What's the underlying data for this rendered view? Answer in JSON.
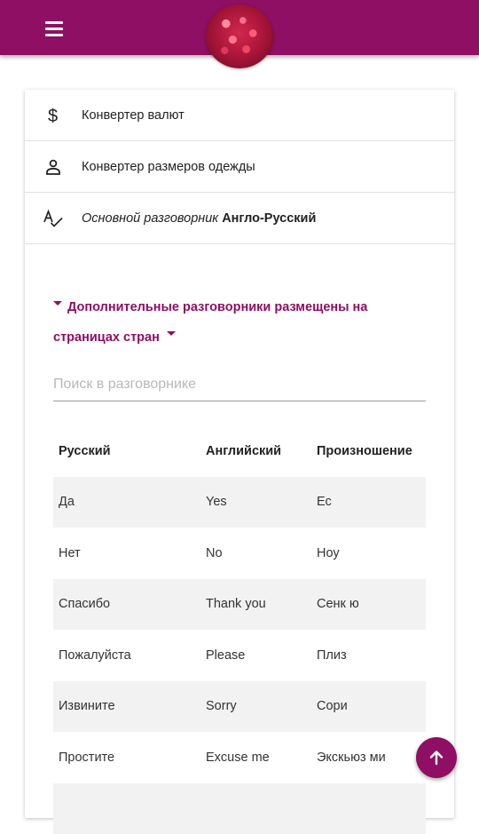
{
  "brand_color": "#8e0f63",
  "header": {
    "menu_icon": "hamburger-menu-icon",
    "avatar_icon": "raspberry-avatar"
  },
  "nav": [
    {
      "icon": "dollar-icon",
      "label": "Конвертер валют"
    },
    {
      "icon": "person-icon",
      "label": "Конвертер размеров одежды"
    },
    {
      "icon": "spellcheck-icon",
      "label_italic": "Основной разговорник",
      "label_bold": "Англо-Русский"
    }
  ],
  "extra_phrasebooks_link": "Дополнительные разговорники размещены на страницах стран",
  "search": {
    "placeholder": "Поиск в разговорнике",
    "value": ""
  },
  "table": {
    "headers": [
      "Русский",
      "Английский",
      "Произношение"
    ],
    "rows": [
      [
        "Да",
        "Yes",
        "Ес"
      ],
      [
        "Нет",
        "No",
        "Ноу"
      ],
      [
        "Спасибо",
        "Thank you",
        "Сенк ю"
      ],
      [
        "Пожалуйста",
        "Please",
        "Плиз"
      ],
      [
        "Извините",
        "Sorry",
        "Сори"
      ],
      [
        "Простите",
        "Excuse me",
        "Экскьюз ми"
      ],
      [
        "",
        "",
        ""
      ]
    ]
  },
  "fab_icon": "arrow-up-icon"
}
